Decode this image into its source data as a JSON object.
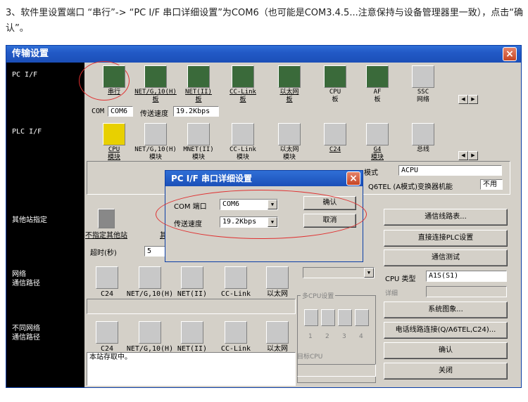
{
  "caption": "3、软件里设置端口 “串行”-> “PC I/F 串口详细设置”为COM6（也可能是COM3.4.5...注意保持与设备管理器里一致），点击“确认”。",
  "window": {
    "title": "传输设置",
    "close": "×"
  },
  "left": {
    "pcif": "PC I/F",
    "plcif": "PLC I/F",
    "other": "其他站指定",
    "net": "网络\n通信路径",
    "diffnet": "不同网络\n通信路径"
  },
  "pcif": {
    "items": [
      "串行",
      "NET/G,10(H)\n板",
      "NET(II)\n板",
      "CC-Link\n板",
      "以太网\n板",
      "CPU\n板",
      "AF\n板",
      "SSC\n网络"
    ],
    "com_label": "COM",
    "com_value": "COM6",
    "speed_label": "传送速度",
    "speed_value": "19.2Kbps"
  },
  "plcif": {
    "items": [
      "CPU\n模块",
      "NET/G,10(H)\n模块",
      "MNET(II)\n模块",
      "CC-Link\n模块",
      "以太网\n模块",
      "C24",
      "G4\n模块",
      "总线"
    ],
    "mode_label": "模式",
    "mode_value": "ACPU",
    "q6tel_label": "Q6TEL (A模式)变换器机能",
    "q6tel_value": "不用"
  },
  "other": {
    "item1": "不指定其他站",
    "item2": "其",
    "timeout_label": "超时(秒)",
    "timeout_value": "5"
  },
  "net": {
    "items": [
      "C24",
      "NET/G,10(H)",
      "NET(II)",
      "CC-Link",
      "以太网"
    ]
  },
  "diffnet": {
    "items": [
      "C24",
      "NET/G,10(H)",
      "NET(II)",
      "CC-Link",
      "以太网"
    ]
  },
  "status": "本站存取中。",
  "multicpu": {
    "label": "多CPU设置",
    "nums": [
      "1",
      "2",
      "3",
      "4"
    ],
    "target": "目标CPU"
  },
  "right": {
    "line_list": "通信线路表...",
    "direct": "直接连接PLC设置",
    "test": "通信测试",
    "cpu_type_label": "CPU 类型",
    "cpu_type_value": "A1S(S1)",
    "detail_label": "详细",
    "sysimg": "系统图象...",
    "phone": "电话线路连接(Q/A6TEL,C24)...",
    "ok": "确认",
    "close": "关闭"
  },
  "dialog": {
    "title": "PC I/F 串口详细设置",
    "com_label": "COM 端口",
    "com_value": "COM6",
    "speed_label": "传送速度",
    "speed_value": "19.2Kbps",
    "ok": "确认",
    "cancel": "取消"
  }
}
